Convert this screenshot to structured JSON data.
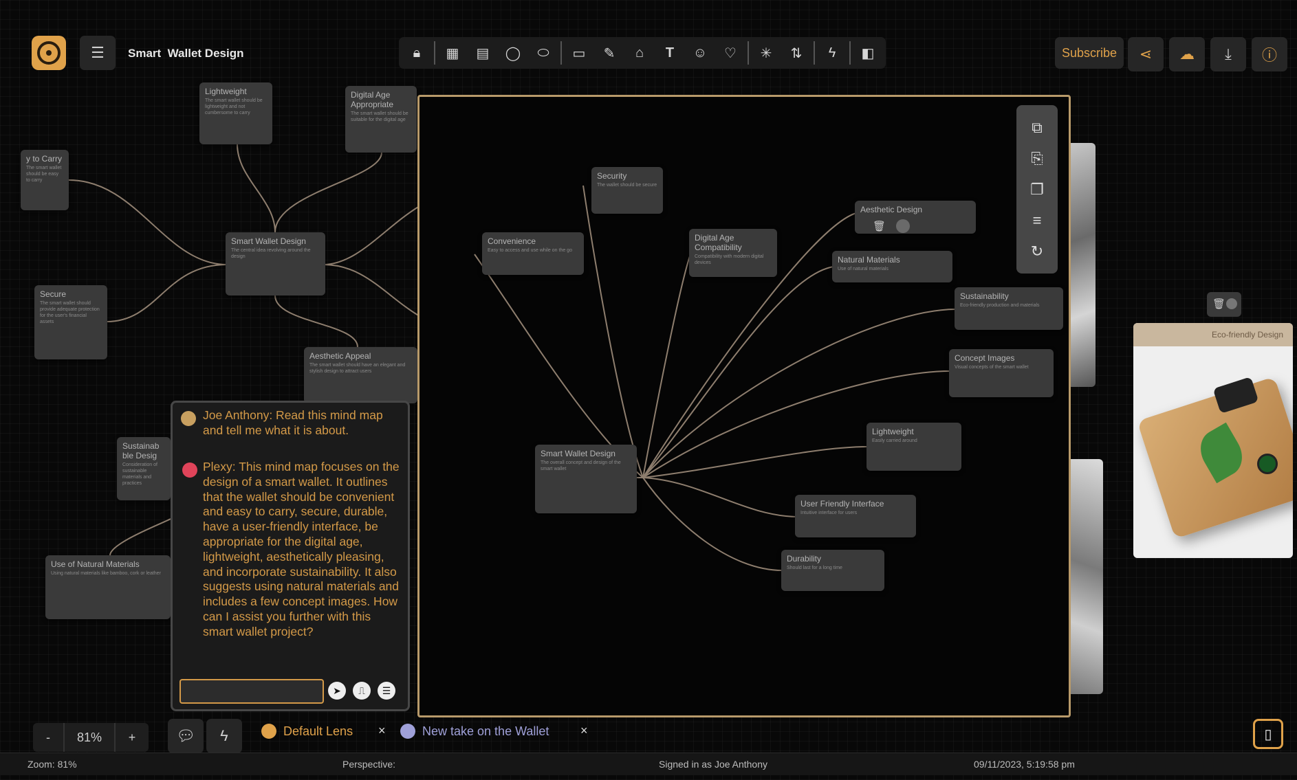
{
  "app": {
    "title": "Smart  Wallet Design"
  },
  "header": {
    "subscribe_label": "Subscribe"
  },
  "toolbar": {
    "icons": [
      "lock-icon",
      "grid-icon",
      "list-icon",
      "circle-icon",
      "pill-icon",
      "rectangle-icon",
      "pen-icon",
      "tag-icon",
      "text-icon",
      "emoji-icon",
      "heart-icon",
      "network-icon",
      "sort-icon",
      "bolt-icon",
      "panel-icon"
    ]
  },
  "nodes_outer": [
    {
      "title": "Lightweight",
      "desc": "The smart wallet should be lightweight and not cumbersome to carry"
    },
    {
      "title": "Digital Age Appropriate",
      "desc": "The smart wallet should be suitable for the digital age"
    },
    {
      "title": "y to Carry",
      "desc": "The smart wallet should be easy to carry"
    },
    {
      "title": "Smart Wallet Design",
      "desc": "The central idea revolving around the design"
    },
    {
      "title": "Secure",
      "desc": "The smart wallet should provide adequate protection for the user's financial assets"
    },
    {
      "title": "Aesthetic Appeal",
      "desc": "The smart wallet should have an elegant and stylish design to attract users"
    },
    {
      "title": "Sustainab ble Desig",
      "desc": "Consideration of sustainable materials and practices"
    },
    {
      "title": "Use of Natural Materials",
      "desc": "Using natural materials like bamboo, cork or leather"
    }
  ],
  "nodes_focus": [
    {
      "title": "Security",
      "desc": "The wallet should be secure"
    },
    {
      "title": "Convenience",
      "desc": "Easy to access and use while on the go"
    },
    {
      "title": "Digital Age Compatibility",
      "desc": "Compatibility with modern digital devices"
    },
    {
      "title": "Aesthetic Design",
      "desc": "Sleek and modern look"
    },
    {
      "title": "Natural Materials",
      "desc": "Use of natural materials"
    },
    {
      "title": "Sustainability",
      "desc": "Eco-friendly production and materials"
    },
    {
      "title": "Concept Images",
      "desc": "Visual concepts of the smart wallet"
    },
    {
      "title": "Smart Wallet Design",
      "desc": "The overall concept and design of the smart wallet"
    },
    {
      "title": "Lightweight",
      "desc": "Easily carried around"
    },
    {
      "title": "User Friendly Interface",
      "desc": "Intuitive interface for users"
    },
    {
      "title": "Durability",
      "desc": "Should last for a long time"
    }
  ],
  "image_card": {
    "title": "Eco-friendly Design"
  },
  "chat": {
    "user_message": "Joe Anthony: Read this mind map and tell me what it is about.",
    "ai_message": "Plexy: This mind map focuses on the design of a smart wallet. It outlines that the wallet should be convenient and easy to carry, secure, durable, have a user-friendly interface, be appropriate for the digital age, lightweight, aesthetically pleasing, and incorporate sustainability. It also suggests using natural materials and includes a few concept images. How can I assist you further with this smart wallet project?",
    "input_value": ""
  },
  "zoom": {
    "minus": "-",
    "value": "81%",
    "plus": "+"
  },
  "lenses": [
    {
      "label": "Default Lens",
      "color": "#e0a24a",
      "close": "×"
    },
    {
      "label": "New take on the Wallet",
      "color": "#9fa0d8",
      "close": "×"
    }
  ],
  "status": {
    "zoom": "Zoom: 81%",
    "perspective": "Perspective:",
    "signed_in": "Signed in as Joe Anthony",
    "datetime": "09/11/2023, 5:19:58 pm"
  },
  "colors": {
    "accent": "#e0a24a",
    "canvas": "#080808",
    "node": "#3a3a3a",
    "focus_border": "#b89a6a"
  }
}
